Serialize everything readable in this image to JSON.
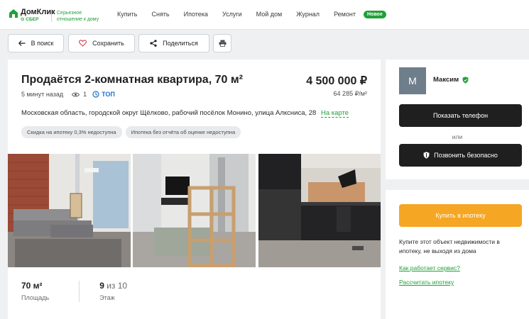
{
  "header": {
    "logo_name": "ДомКлик",
    "logo_sub": "СБЕР",
    "tagline": "Серьезное отношение к дому",
    "nav": [
      "Купить",
      "Снять",
      "Ипотека",
      "Услуги",
      "Мой дом",
      "Журнал",
      "Ремонт"
    ],
    "badge": "Новое"
  },
  "actions": {
    "back": "В поиск",
    "save": "Сохранить",
    "share": "Поделиться"
  },
  "listing": {
    "title": "Продаётся 2-комнатная квартира, 70 м²",
    "price": "4 500 000 ₽",
    "price_per_m2": "64 285 ₽/м²",
    "posted": "5 минут назад",
    "views": "1",
    "top_badge": "ТОП",
    "address": "Московская область, городской округ Щёлково, рабочий посёлок Монино, улица Алксниса, 28",
    "map_link": "На карте",
    "tags": [
      "Скидка на ипотеку 0,3% недоступна",
      "Ипотека без отчёта об оценке недоступна"
    ],
    "stats": {
      "area_value": "70 м²",
      "area_label": "Площадь",
      "floor_value": "9",
      "floor_of": "из 10",
      "floor_label": "Этаж"
    }
  },
  "agent": {
    "initial": "М",
    "name": "Максим",
    "show_phone": "Показать телефон",
    "or": "или",
    "call_free": "Позвонить безопасно"
  },
  "mortgage": {
    "button": "Купить в ипотеку",
    "text": "Купите этот объект недвижимости в ипотеку, не выходя из дома",
    "link1": "Как работает сервис?",
    "link2": "Рассчитать ипотеку"
  },
  "colors": {
    "brand_green": "#21a038",
    "accent_orange": "#f5a623",
    "dark_button": "#1f1f1f",
    "top_blue": "#1e6fcf"
  }
}
